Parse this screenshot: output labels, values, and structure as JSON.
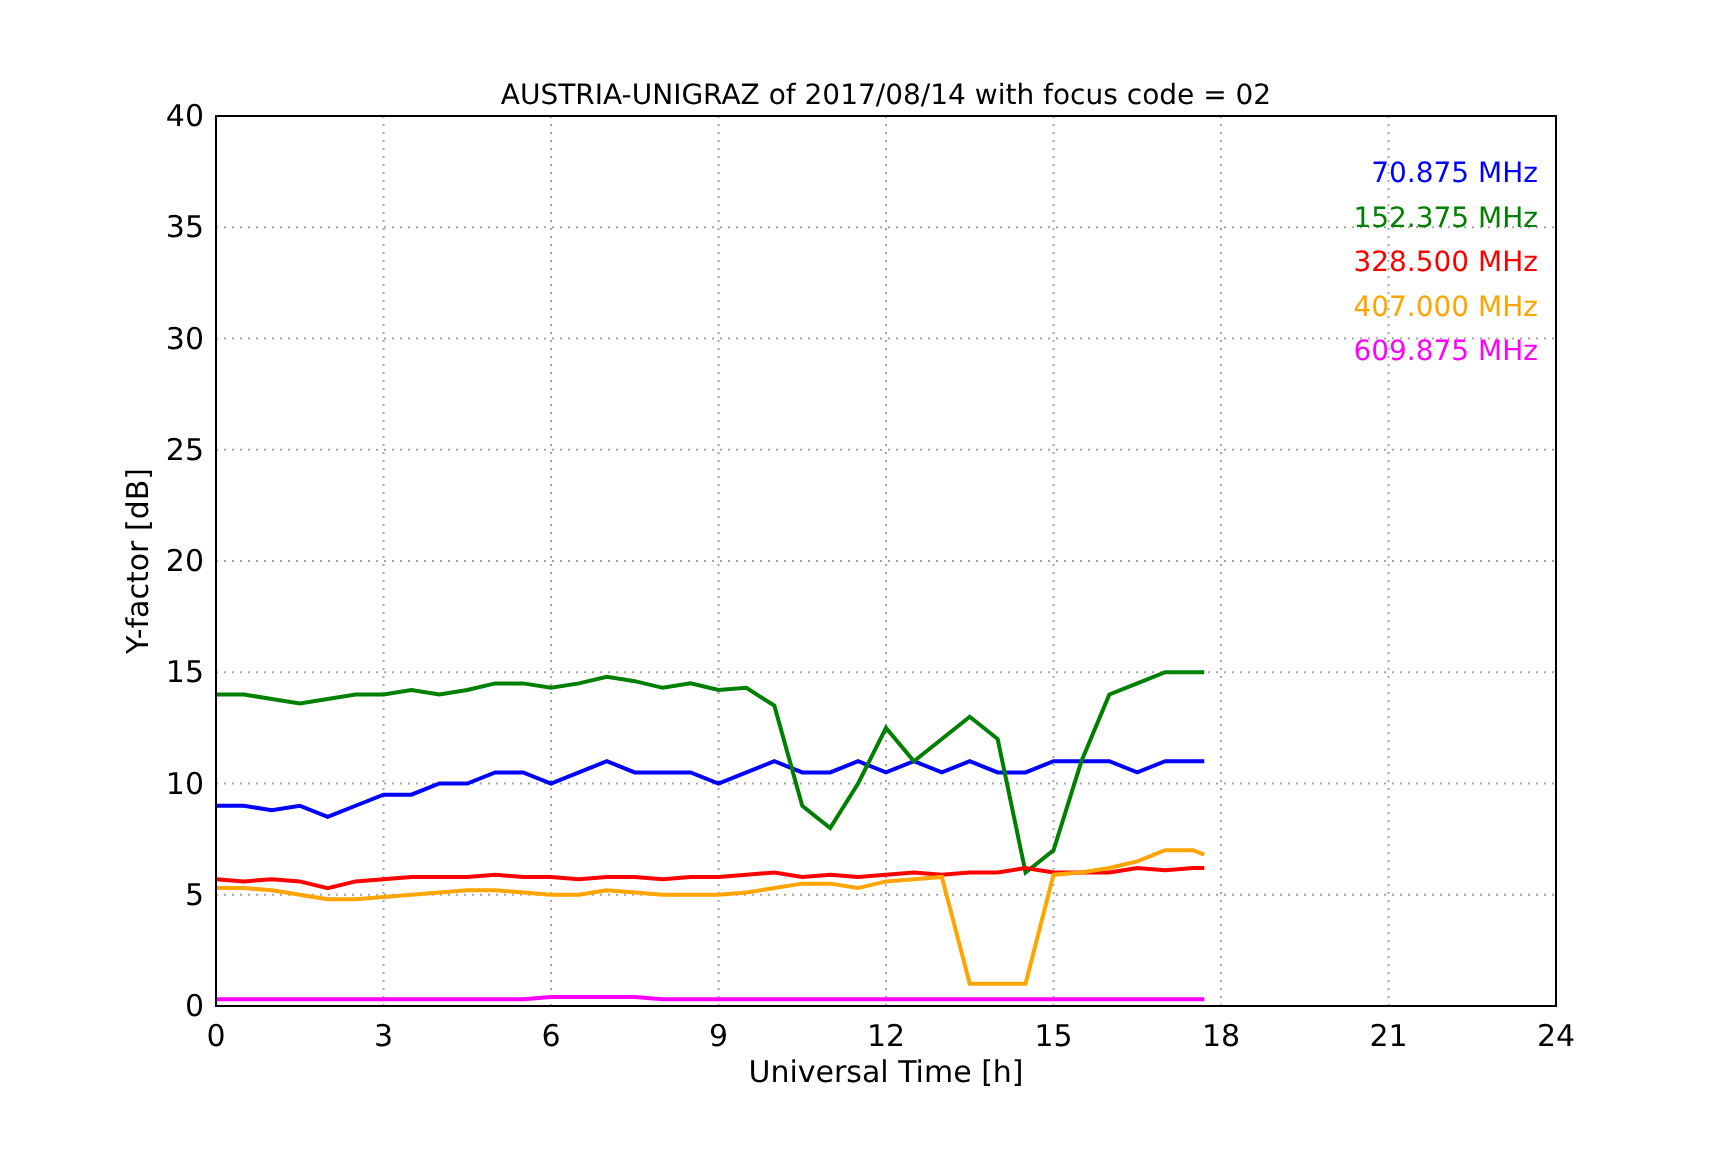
{
  "chart_data": {
    "type": "line",
    "grid": true,
    "title": "AUSTRIA-UNIGRAZ of 2017/08/14 with focus code = 02",
    "xlabel": "Universal Time [h]",
    "ylabel": "Y-factor [dB]",
    "xlim": [
      0,
      24
    ],
    "ylim": [
      0,
      40
    ],
    "xticks": [
      0,
      3,
      6,
      9,
      12,
      15,
      18,
      21,
      24
    ],
    "yticks": [
      0,
      5,
      10,
      15,
      20,
      25,
      30,
      35,
      40
    ],
    "x": [
      0,
      0.5,
      1,
      1.5,
      2,
      2.5,
      3,
      3.5,
      4,
      4.5,
      5,
      5.5,
      6,
      6.5,
      7,
      7.5,
      8,
      8.5,
      9,
      9.5,
      10,
      10.5,
      11,
      11.5,
      12,
      12.5,
      13,
      13.5,
      14,
      14.5,
      15,
      15.5,
      16,
      16.5,
      17,
      17.5,
      17.7
    ],
    "series": [
      {
        "name": "70.875 MHz",
        "color": "#0000ff",
        "values": [
          9,
          9,
          8.8,
          9,
          8.5,
          9,
          9.5,
          9.5,
          10,
          10,
          10.5,
          10.5,
          10,
          10.5,
          11,
          10.5,
          10.5,
          10.5,
          10,
          10.5,
          11,
          10.5,
          10.5,
          11,
          10.5,
          11,
          10.5,
          11,
          10.5,
          10.5,
          11,
          11,
          11,
          10.5,
          11,
          11,
          11
        ]
      },
      {
        "name": "152.375 MHz",
        "color": "#008000",
        "values": [
          14,
          14,
          13.8,
          13.6,
          13.8,
          14,
          14,
          14.2,
          14,
          14.2,
          14.5,
          14.5,
          14.3,
          14.5,
          14.8,
          14.6,
          14.3,
          14.5,
          14.2,
          14.3,
          13.5,
          9,
          8,
          10,
          12.5,
          11,
          12,
          13,
          12,
          6,
          7,
          11,
          14,
          14.5,
          15,
          15,
          15
        ]
      },
      {
        "name": "328.500 MHz",
        "color": "#ff0000",
        "values": [
          5.7,
          5.6,
          5.7,
          5.6,
          5.3,
          5.6,
          5.7,
          5.8,
          5.8,
          5.8,
          5.9,
          5.8,
          5.8,
          5.7,
          5.8,
          5.8,
          5.7,
          5.8,
          5.8,
          5.9,
          6,
          5.8,
          5.9,
          5.8,
          5.9,
          6,
          5.9,
          6,
          6,
          6.2,
          6,
          6,
          6,
          6.2,
          6.1,
          6.2,
          6.2
        ]
      },
      {
        "name": "407.000 MHz",
        "color": "#ffa500",
        "values": [
          5.3,
          5.3,
          5.2,
          5,
          4.8,
          4.8,
          4.9,
          5,
          5.1,
          5.2,
          5.2,
          5.1,
          5,
          5,
          5.2,
          5.1,
          5,
          5,
          5,
          5.1,
          5.3,
          5.5,
          5.5,
          5.3,
          5.6,
          5.7,
          5.8,
          1,
          1,
          1,
          5.9,
          6,
          6.2,
          6.5,
          7,
          7,
          6.8
        ]
      },
      {
        "name": "609.875 MHz",
        "color": "#ff00ff",
        "values": [
          0.3,
          0.3,
          0.3,
          0.3,
          0.3,
          0.3,
          0.3,
          0.3,
          0.3,
          0.3,
          0.3,
          0.3,
          0.4,
          0.4,
          0.4,
          0.4,
          0.3,
          0.3,
          0.3,
          0.3,
          0.3,
          0.3,
          0.3,
          0.3,
          0.3,
          0.3,
          0.3,
          0.3,
          0.3,
          0.3,
          0.3,
          0.3,
          0.3,
          0.3,
          0.3,
          0.3,
          0.3
        ]
      }
    ]
  }
}
